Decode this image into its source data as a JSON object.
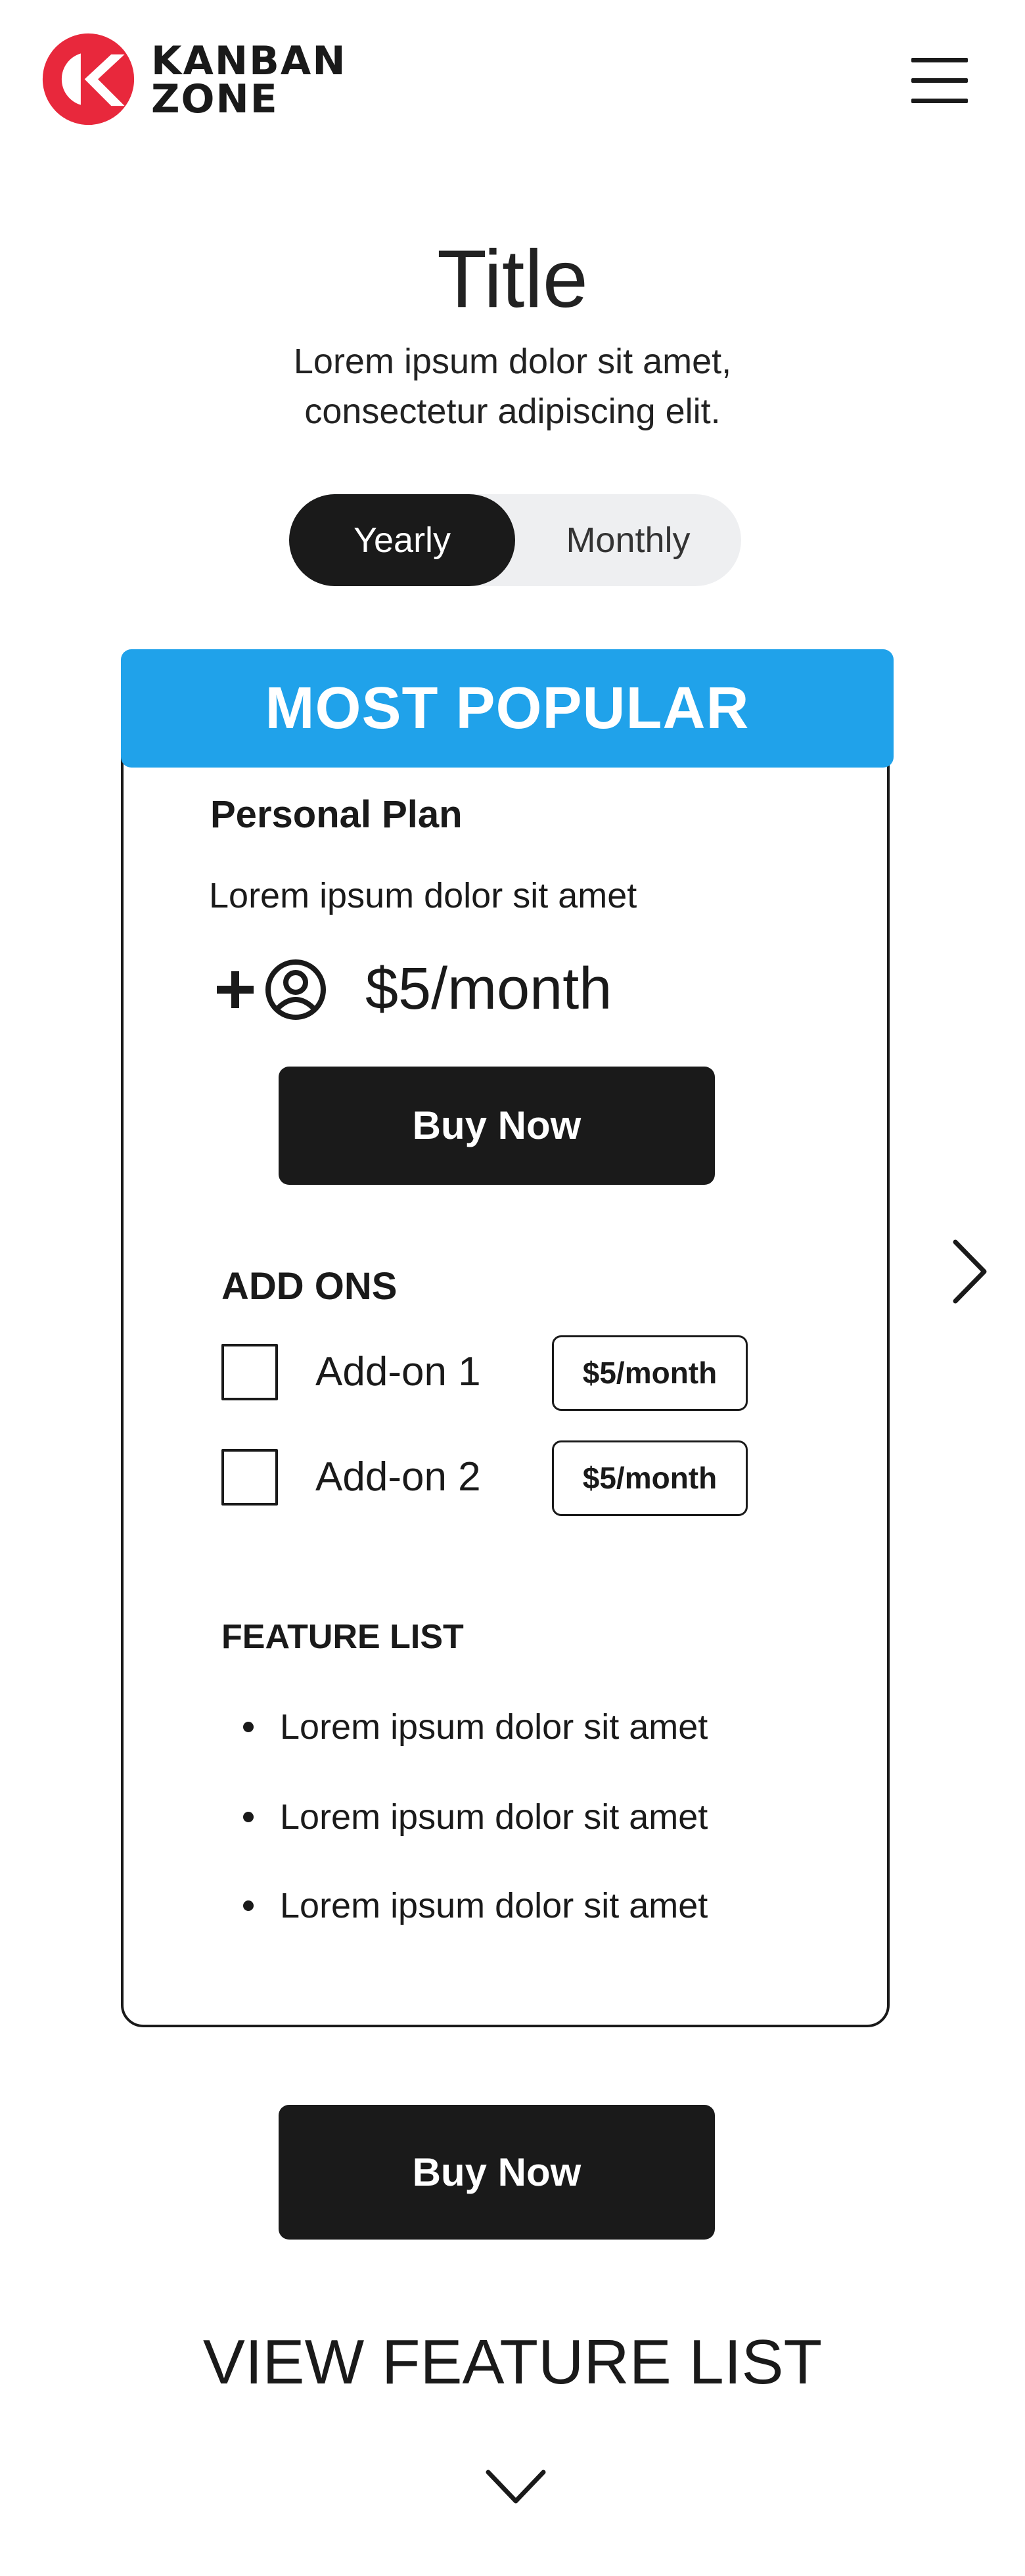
{
  "header": {
    "logo_line1": "KANBAN",
    "logo_line2": "ZONE",
    "logo_color": "#e8283c",
    "menu_icon": "hamburger-menu-icon"
  },
  "hero": {
    "title": "Title",
    "subtitle": "Lorem ipsum dolor sit amet, consectetur adipiscing elit."
  },
  "billing_toggle": {
    "options": [
      "Yearly",
      "Monthly"
    ],
    "selected": "Yearly"
  },
  "plan_card": {
    "badge": "MOST POPULAR",
    "badge_color": "#20a2ea",
    "name": "Personal Plan",
    "description": "Lorem ipsum dolor sit amet",
    "price_icon": "add-user-icon",
    "price": "$5/month",
    "buy_label": "Buy Now",
    "addons_heading": "ADD ONS",
    "addons": [
      {
        "label": "Add-on 1",
        "price": "$5/month",
        "checked": false
      },
      {
        "label": "Add-on 2",
        "price": "$5/month",
        "checked": false
      }
    ],
    "features_heading": "FEATURE LIST",
    "features": [
      "Lorem ipsum dolor sit amet",
      "Lorem ipsum dolor sit amet",
      "Lorem ipsum dolor sit amet"
    ],
    "next_icon": "chevron-right-icon"
  },
  "footer": {
    "buy_label": "Buy Now",
    "view_features": "VIEW FEATURE LIST",
    "expand_icon": "chevron-down-icon"
  }
}
